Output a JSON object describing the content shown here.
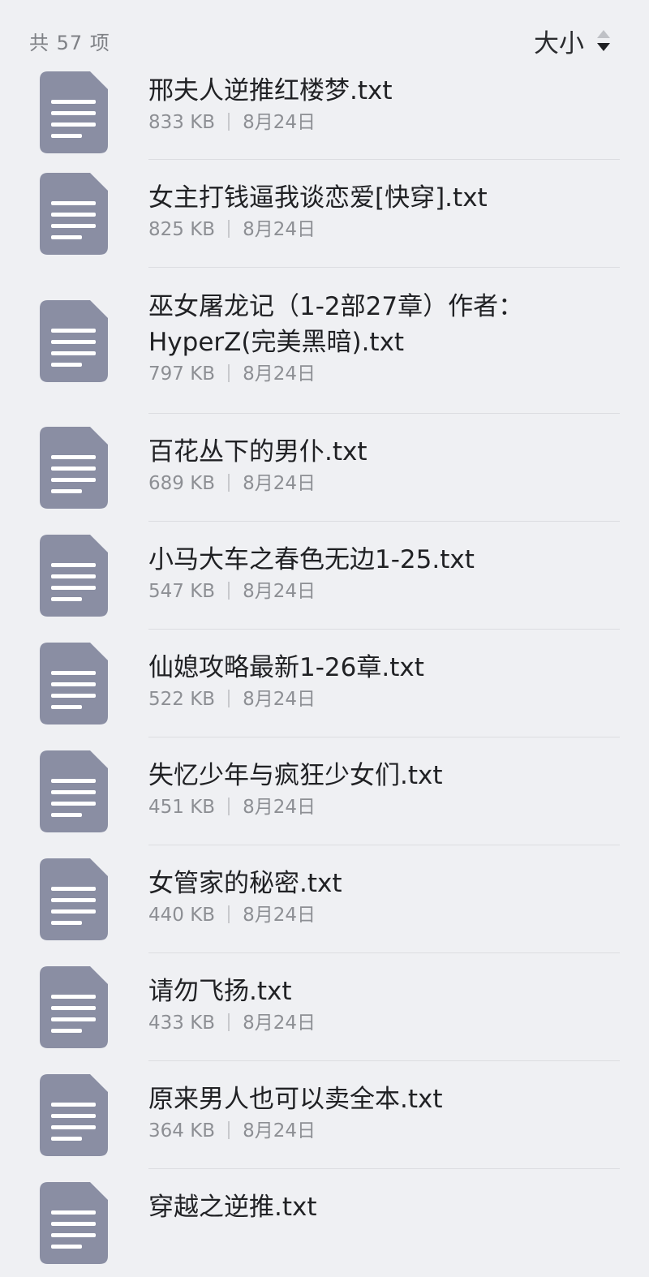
{
  "header": {
    "count_text": "共 57 项",
    "sort_label": "大小"
  },
  "colors": {
    "background": "#eff0f3",
    "file_icon": "#8a8ea3",
    "file_lines": "#ffffff"
  },
  "files": [
    {
      "name": "邢夫人逆推红楼梦.txt",
      "size": "833 KB",
      "date": "8月24日"
    },
    {
      "name": "女主打钱逼我谈恋爱[快穿].txt",
      "size": "825 KB",
      "date": "8月24日"
    },
    {
      "name": "巫女屠龙记（1-2部27章）作者：HyperZ(完美黑暗).txt",
      "size": "797 KB",
      "date": "8月24日"
    },
    {
      "name": "百花丛下的男仆.txt",
      "size": "689 KB",
      "date": "8月24日"
    },
    {
      "name": "小马大车之春色无边1-25.txt",
      "size": "547 KB",
      "date": "8月24日"
    },
    {
      "name": "仙媳攻略最新1-26章.txt",
      "size": "522 KB",
      "date": "8月24日"
    },
    {
      "name": "失忆少年与疯狂少女们.txt",
      "size": "451 KB",
      "date": "8月24日"
    },
    {
      "name": "女管家的秘密.txt",
      "size": "440 KB",
      "date": "8月24日"
    },
    {
      "name": "请勿飞扬.txt",
      "size": "433 KB",
      "date": "8月24日"
    },
    {
      "name": "原来男人也可以卖全本.txt",
      "size": "364 KB",
      "date": "8月24日"
    },
    {
      "name": "穿越之逆推.txt",
      "size": "",
      "date": ""
    }
  ]
}
